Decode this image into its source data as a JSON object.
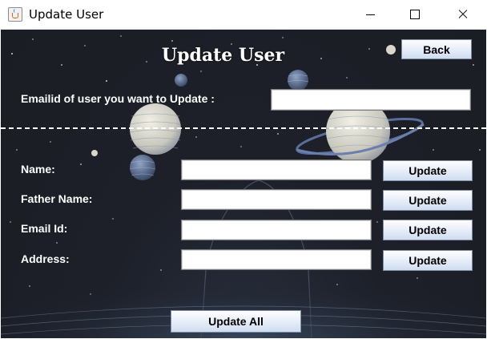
{
  "window": {
    "title": "Update User",
    "icon": "java-cup-icon"
  },
  "page": {
    "heading": "Update User",
    "back_label": "Back"
  },
  "lookup": {
    "label": "Emailid of user you want to Update :",
    "value": ""
  },
  "fields": [
    {
      "label": "Name:",
      "value": "",
      "button": "Update"
    },
    {
      "label": "Father Name:",
      "value": "",
      "button": "Update"
    },
    {
      "label": "Email Id:",
      "value": "",
      "button": "Update"
    },
    {
      "label": "Address:",
      "value": "",
      "button": "Update"
    }
  ],
  "footer": {
    "update_all_label": "Update All"
  },
  "colors": {
    "background": "#1d2029",
    "text": "#ffffff",
    "button_top": "#fdfdff",
    "button_bottom": "#cfdcf0"
  }
}
